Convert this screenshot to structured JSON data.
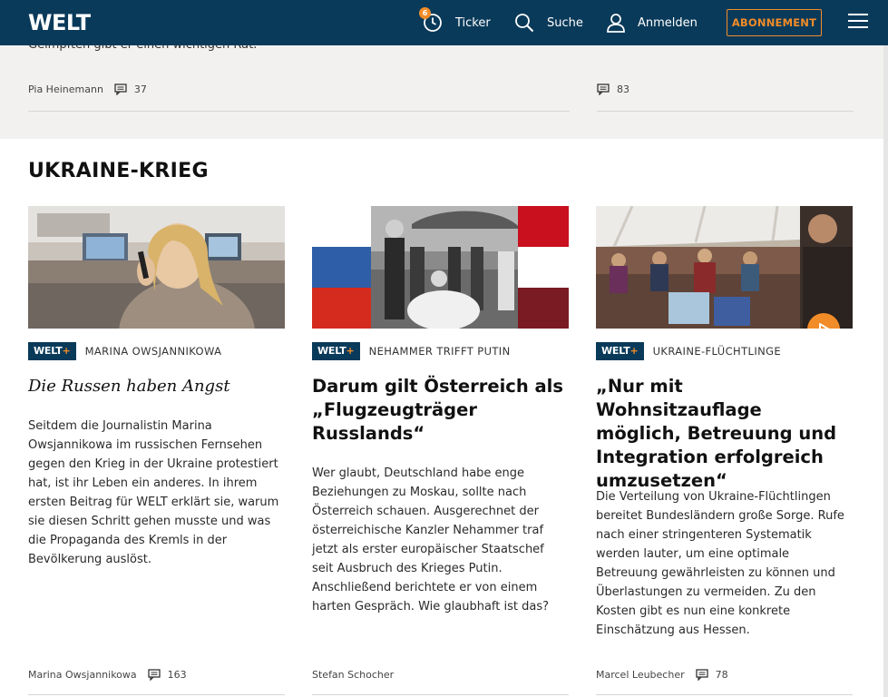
{
  "header": {
    "logo": "WELT",
    "ticker_badge": "6",
    "ticker_label": "Ticker",
    "search_label": "Suche",
    "login_label": "Anmelden",
    "subscribe_label": "ABONNEMENT"
  },
  "previous_section": {
    "snippet": "Geimpften gibt er einen wichtigen Rat.",
    "items": [
      {
        "author": "Pia Heinemann",
        "comments": "37"
      },
      {
        "author": "",
        "comments": "83"
      }
    ]
  },
  "section": {
    "title": "UKRAINE-KRIEG",
    "cards": [
      {
        "badge_main": "WELT",
        "badge_plus": "+",
        "topic": "MARINA OWSJANNIKOWA",
        "headline": "Die Russen haben Angst",
        "teaser": "Seitdem die Journalistin Marina Owsjannikowa im russischen Fernsehen gegen den Krieg in der Ukraine protestiert hat, ist ihr Leben ein anderes. In ihrem ersten Beitrag für WELT erklärt sie, warum sie diesen Schritt gehen musste und was die Propaganda des Kremls in der Bevölkerung auslöst.",
        "author": "Marina Owsjannikowa",
        "comments": "163"
      },
      {
        "badge_main": "WELT",
        "badge_plus": "+",
        "topic": "NEHAMMER TRIFFT PUTIN",
        "headline": "Darum gilt Österreich als „Flugzeugträger Russlands“",
        "teaser": "Wer glaubt, Deutschland habe enge Beziehungen zu Moskau, sollte nach Österreich schauen. Ausgerechnet der österreichische Kanzler Nehammer traf jetzt als erster europäischer Staatschef seit Ausbruch des Krieges Putin. Anschließend berichtete er von einem harten Gespräch. Wie glaubhaft ist das?",
        "author": "Stefan Schocher",
        "comments": ""
      },
      {
        "badge_main": "WELT",
        "badge_plus": "+",
        "topic": "UKRAINE-FLÜCHTLINGE",
        "headline": "„Nur mit Wohnsitzauflage möglich, Betreuung und Integration erfolgreich umzusetzen“",
        "teaser": "Die Verteilung von Ukraine-Flüchtlingen bereitet Bundesländern große Sorge. Rufe nach einer stringenteren Systematik werden lauter, um eine optimale Betreuung gewährleisten zu können und Überlastungen zu vermeiden. Zu den Kosten gibt es nun eine konkrete Einschätzung aus Hessen.",
        "author": "Marcel Leubecher",
        "comments": "78"
      }
    ]
  },
  "colors": {
    "brand_navy": "#0a3a5a",
    "accent_orange": "#f28c28",
    "strip_bg": "#f2f1ef"
  }
}
